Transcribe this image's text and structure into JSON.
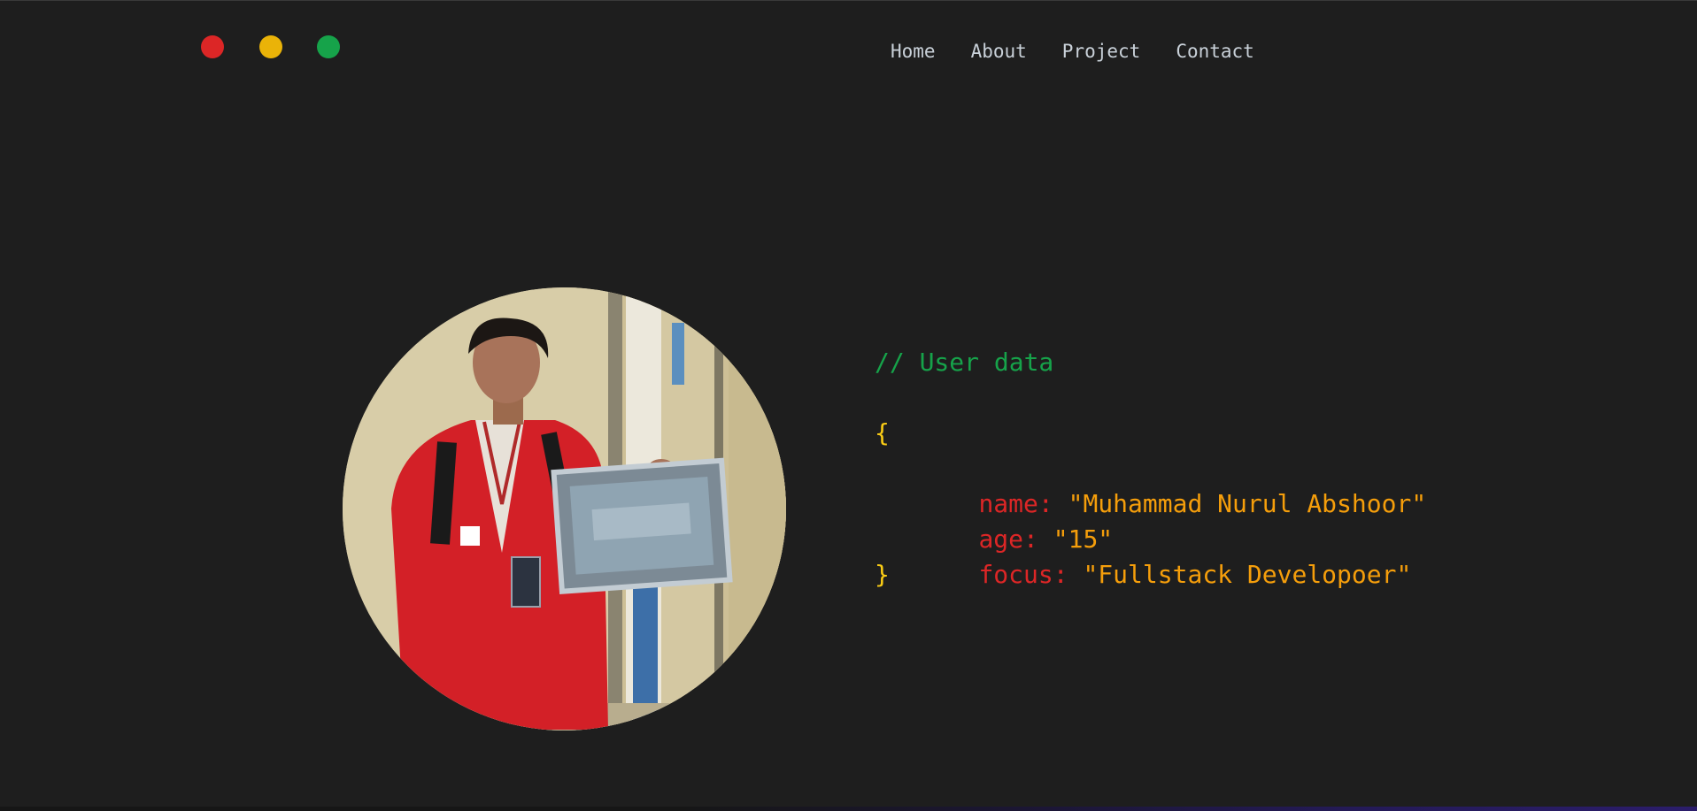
{
  "window": {
    "controls": [
      {
        "name": "close",
        "color": "#dc2626"
      },
      {
        "name": "minimize",
        "color": "#eab308"
      },
      {
        "name": "maximize",
        "color": "#16a34a"
      }
    ]
  },
  "nav": {
    "items": [
      {
        "label": "Home"
      },
      {
        "label": "About"
      },
      {
        "label": "Project"
      },
      {
        "label": "Contact"
      }
    ]
  },
  "profile": {
    "photo_subject": "person in red blazer holding a blurred certificate"
  },
  "code": {
    "comment": "// User data",
    "open_brace": "{",
    "close_brace": "}",
    "fields": [
      {
        "key": "name:",
        "value": "\"Muhammad Nurul Abshoor\""
      },
      {
        "key": "age:",
        "value": "\"15\""
      },
      {
        "key": "focus:",
        "value": "\"Fullstack Developoer\""
      }
    ]
  },
  "colors": {
    "background": "#1e1e1e",
    "comment": "#16a34a",
    "brace": "#facc15",
    "key": "#dc2626",
    "string": "#f59e0b",
    "nav_text": "#c9d1d9"
  }
}
